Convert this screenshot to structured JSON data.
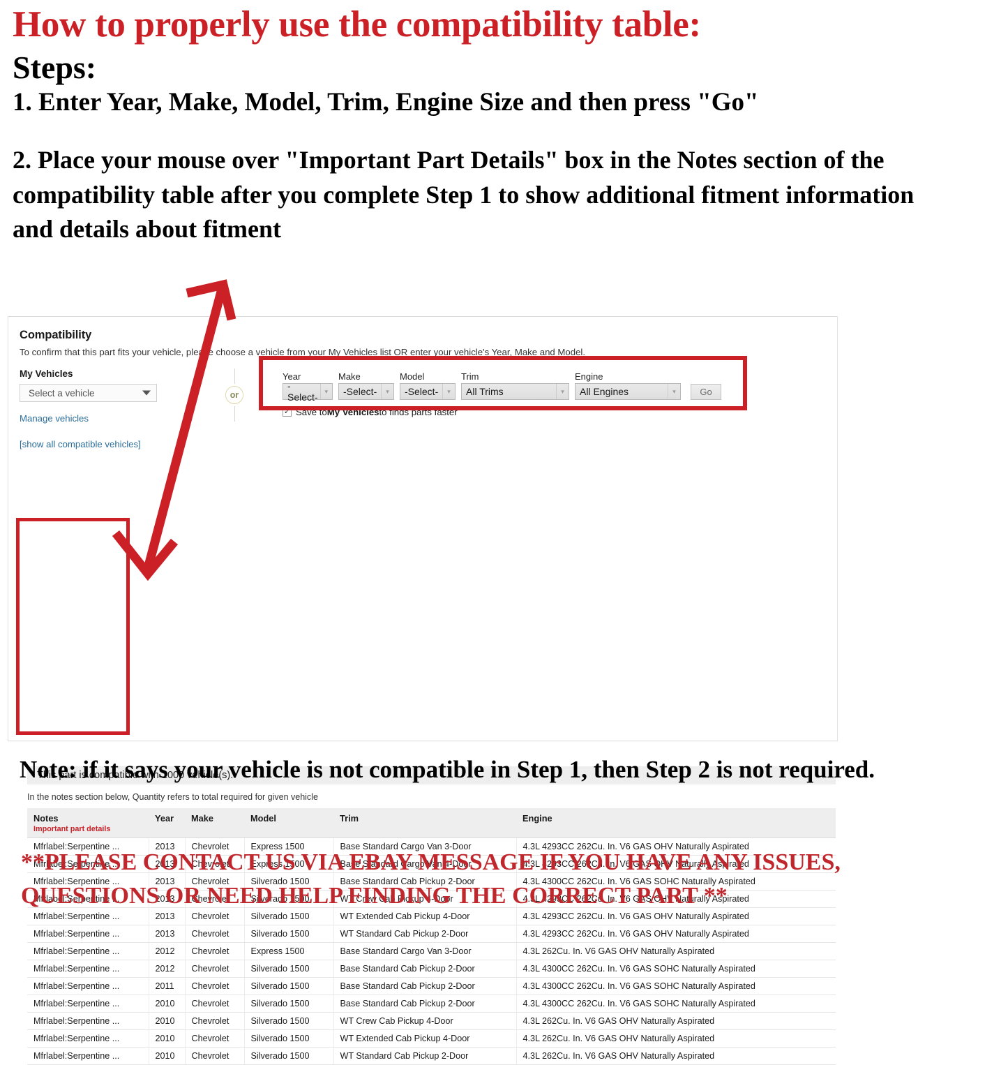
{
  "instructions": {
    "headline": "How to properly use the compatibility table:",
    "steps_label": "Steps:",
    "step_1": "1. Enter Year, Make, Model, Trim, Engine Size and then press \"Go\"",
    "step_2": "2. Place your mouse over \"Important Part Details\" box in the Notes section of the compatibility table after you complete Step 1 to show additional fitment information and details about fitment"
  },
  "compatibility": {
    "title": "Compatibility",
    "subtitle": "To confirm that this part fits your vehicle, please choose a vehicle from your My Vehicles list OR enter your vehicle's Year, Make and Model.",
    "my_vehicles_label": "My Vehicles",
    "vehicle_select_value": "Select a vehicle",
    "manage_vehicles_link": "Manage vehicles",
    "show_all_link": "[show all compatible vehicles]",
    "or_label": "or",
    "fields": {
      "year_label": "Year",
      "year_value": "-Select-",
      "make_label": "Make",
      "make_value": "-Select-",
      "model_label": "Model",
      "model_value": "-Select-",
      "trim_label": "Trim",
      "trim_value": "All Trims",
      "engine_label": "Engine",
      "engine_value": "All Engines",
      "go_label": "Go"
    },
    "save_checkbox": {
      "checked_glyph": "✓",
      "text_before": "Save to ",
      "text_bold": "My Vehicles",
      "text_after": " to finds parts faster"
    },
    "compat_banner": "This part is compatible with 1000 vehicle(s).",
    "notes_hint": "In the notes section below, Quantity refers to total required for given vehicle"
  },
  "table": {
    "headers": {
      "notes": "Notes",
      "notes_sub": "Important part details",
      "year": "Year",
      "make": "Make",
      "model": "Model",
      "trim": "Trim",
      "engine": "Engine"
    },
    "rows": [
      {
        "notes": "Mfrlabel:Serpentine ...",
        "year": "2013",
        "make": "Chevrolet",
        "model": "Express 1500",
        "trim": "Base Standard Cargo Van 3-Door",
        "engine": "4.3L 4293CC 262Cu. In. V6 GAS OHV Naturally Aspirated"
      },
      {
        "notes": "Mfrlabel:Serpentine ...",
        "year": "2013",
        "make": "Chevrolet",
        "model": "Express 1500",
        "trim": "Base Standard Cargo Van 4-Door",
        "engine": "4.3L 4293CC 262Cu. In. V6 GAS OHV Naturally Aspirated"
      },
      {
        "notes": "Mfrlabel:Serpentine ...",
        "year": "2013",
        "make": "Chevrolet",
        "model": "Silverado 1500",
        "trim": "Base Standard Cab Pickup 2-Door",
        "engine": "4.3L 4300CC 262Cu. In. V6 GAS SOHC Naturally Aspirated"
      },
      {
        "notes": "Mfrlabel:Serpentine ...",
        "year": "2013",
        "make": "Chevrolet",
        "model": "Silverado 1500",
        "trim": "WT Crew Cab Pickup 4-Door",
        "engine": "4.3L 4293CC 262Cu. In. V6 GAS OHV Naturally Aspirated"
      },
      {
        "notes": "Mfrlabel:Serpentine ...",
        "year": "2013",
        "make": "Chevrolet",
        "model": "Silverado 1500",
        "trim": "WT Extended Cab Pickup 4-Door",
        "engine": "4.3L 4293CC 262Cu. In. V6 GAS OHV Naturally Aspirated"
      },
      {
        "notes": "Mfrlabel:Serpentine ...",
        "year": "2013",
        "make": "Chevrolet",
        "model": "Silverado 1500",
        "trim": "WT Standard Cab Pickup 2-Door",
        "engine": "4.3L 4293CC 262Cu. In. V6 GAS OHV Naturally Aspirated"
      },
      {
        "notes": "Mfrlabel:Serpentine ...",
        "year": "2012",
        "make": "Chevrolet",
        "model": "Express 1500",
        "trim": "Base Standard Cargo Van 3-Door",
        "engine": "4.3L 262Cu. In. V6 GAS OHV Naturally Aspirated"
      },
      {
        "notes": "Mfrlabel:Serpentine ...",
        "year": "2012",
        "make": "Chevrolet",
        "model": "Silverado 1500",
        "trim": "Base Standard Cab Pickup 2-Door",
        "engine": "4.3L 4300CC 262Cu. In. V6 GAS SOHC Naturally Aspirated"
      },
      {
        "notes": "Mfrlabel:Serpentine ...",
        "year": "2011",
        "make": "Chevrolet",
        "model": "Silverado 1500",
        "trim": "Base Standard Cab Pickup 2-Door",
        "engine": "4.3L 4300CC 262Cu. In. V6 GAS SOHC Naturally Aspirated"
      },
      {
        "notes": "Mfrlabel:Serpentine ...",
        "year": "2010",
        "make": "Chevrolet",
        "model": "Silverado 1500",
        "trim": "Base Standard Cab Pickup 2-Door",
        "engine": "4.3L 4300CC 262Cu. In. V6 GAS SOHC Naturally Aspirated"
      },
      {
        "notes": "Mfrlabel:Serpentine ...",
        "year": "2010",
        "make": "Chevrolet",
        "model": "Silverado 1500",
        "trim": "WT Crew Cab Pickup 4-Door",
        "engine": "4.3L 262Cu. In. V6 GAS OHV Naturally Aspirated"
      },
      {
        "notes": "Mfrlabel:Serpentine ...",
        "year": "2010",
        "make": "Chevrolet",
        "model": "Silverado 1500",
        "trim": "WT Extended Cab Pickup 4-Door",
        "engine": "4.3L 262Cu. In. V6 GAS OHV Naturally Aspirated"
      },
      {
        "notes": "Mfrlabel:Serpentine ...",
        "year": "2010",
        "make": "Chevrolet",
        "model": "Silverado 1500",
        "trim": "WT Standard Cab Pickup 2-Door",
        "engine": "4.3L 262Cu. In. V6 GAS OHV Naturally Aspirated"
      }
    ]
  },
  "footer": {
    "note": "Note: if it says your vehicle is not compatible in Step 1, then Step 2 is not required.",
    "contact": "**PLEASE CONTACT US VIA EBAY MESSAGE IF YOU HAVE ANY ISSUES, QUESTIONS OR NEED HELP FINDING THE CORRECT PART **"
  },
  "colors": {
    "red": "#cc2027",
    "footer_red": "#c0272d",
    "link_blue": "#2b6e9b"
  }
}
